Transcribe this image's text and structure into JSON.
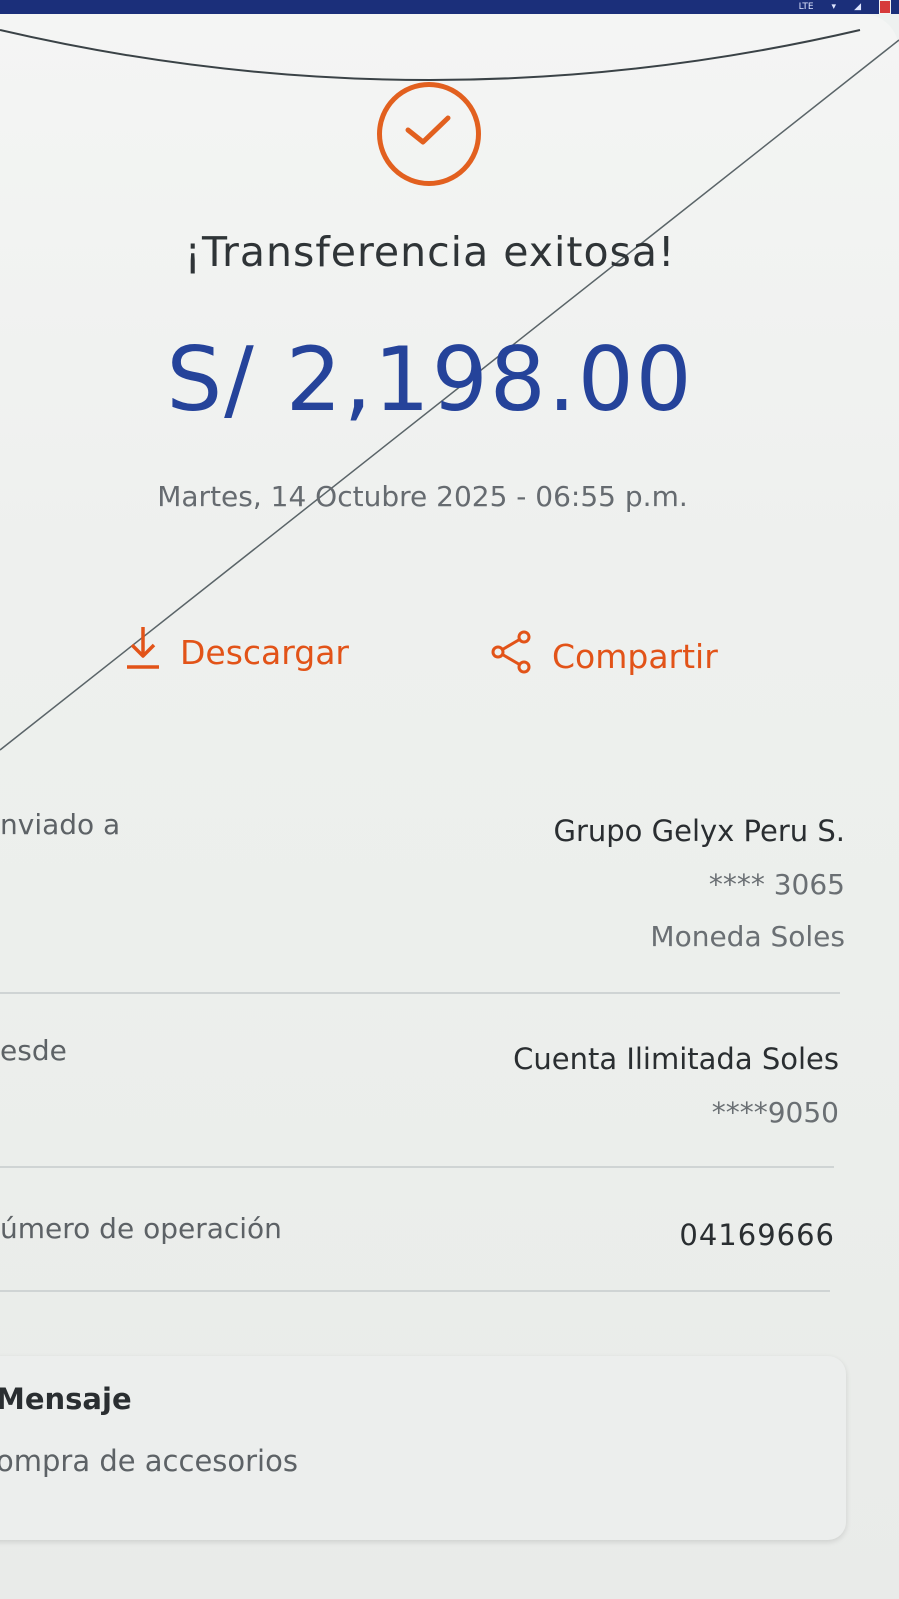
{
  "status_bar": {
    "network_label": "LTE"
  },
  "receipt": {
    "title": "¡Transferencia exitosa!",
    "amount": "S/ 2,198.00",
    "datetime": "Martes, 14 Octubre 2025 - 06:55 p.m.",
    "success_icon": "check-circle-icon"
  },
  "actions": {
    "download_label": "Descargar",
    "download_icon": "download-icon",
    "share_label": "Compartir",
    "share_icon": "share-icon"
  },
  "details": {
    "sent_to": {
      "label": "nviado a",
      "name": "Grupo Gelyx Peru S.",
      "account": "**** 3065",
      "currency": "Moneda Soles"
    },
    "from": {
      "label": "esde",
      "account_name": "Cuenta Ilimitada Soles",
      "account": "****9050"
    },
    "operation": {
      "label": "úmero de operación",
      "number": "04169666"
    }
  },
  "message": {
    "title": "Mensaje",
    "text": "ompra de accesorios"
  },
  "colors": {
    "accent_orange": "#e25318",
    "amount_blue": "#25439a",
    "status_bar_blue": "#1b2f7a"
  }
}
